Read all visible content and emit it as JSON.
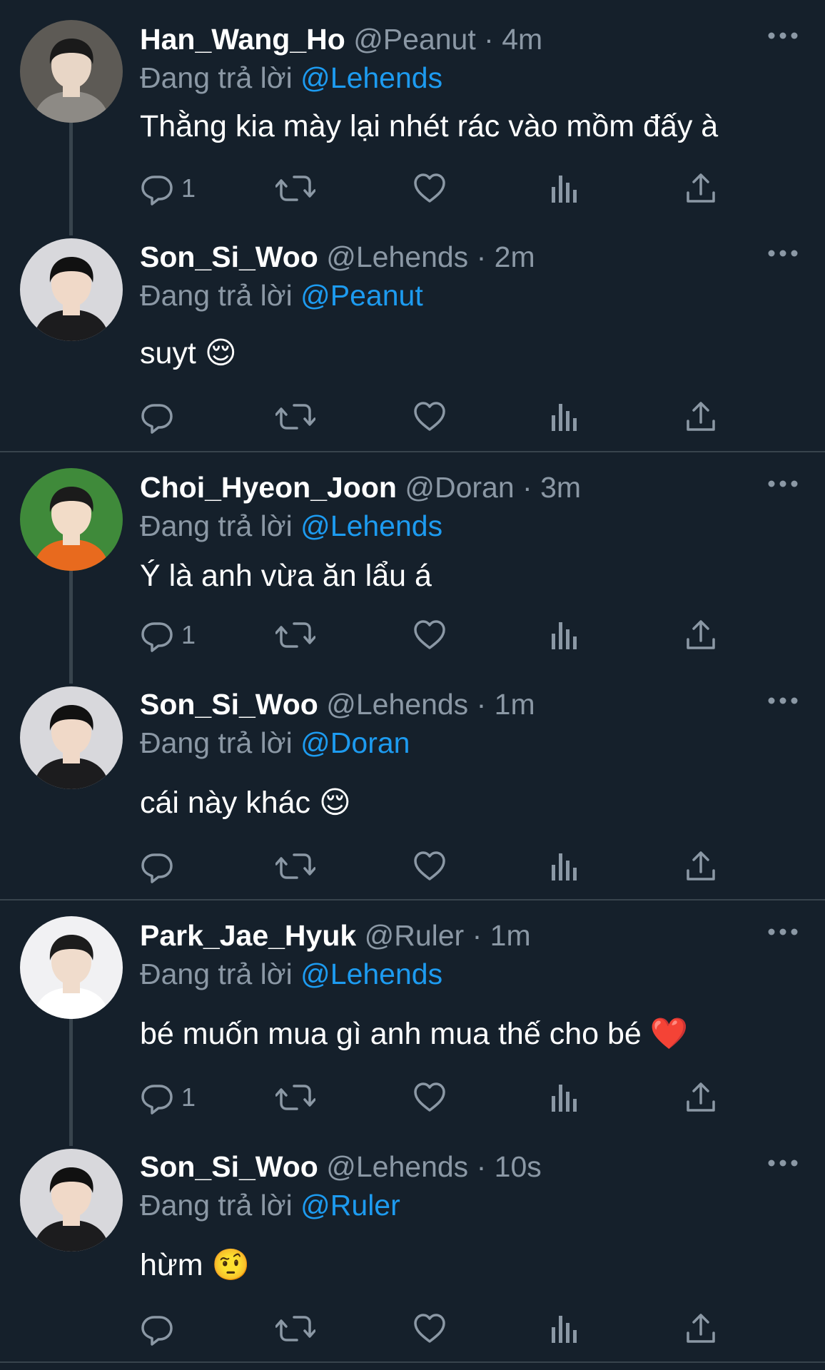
{
  "colors": {
    "background": "#15202b",
    "text": "#ffffff",
    "muted": "#8b98a5",
    "link": "#1d9bf0",
    "divider": "#38444d"
  },
  "labels": {
    "replying_to": "Đang trả lời",
    "dot": "·"
  },
  "tweets": [
    {
      "name": "Han_Wang_Ho",
      "handle": "@Peanut",
      "time": "4m",
      "reply_to": "@Lehends",
      "text": "Thằng kia mày lại nhét rác vào mồm đấy à",
      "emoji": "",
      "reply_count": "1",
      "avatar_icon": "avatar-photo"
    },
    {
      "name": "Son_Si_Woo",
      "handle": "@Lehends",
      "time": "2m",
      "reply_to": "@Peanut",
      "text": "suyt",
      "emoji": "😌",
      "reply_count": "",
      "avatar_icon": "avatar-photo"
    },
    {
      "name": "Choi_Hyeon_Joon",
      "handle": "@Doran",
      "time": "3m",
      "reply_to": "@Lehends",
      "text": "Ý là anh vừa ăn lẩu á",
      "emoji": "",
      "reply_count": "1",
      "avatar_icon": "avatar-photo"
    },
    {
      "name": "Son_Si_Woo",
      "handle": "@Lehends",
      "time": "1m",
      "reply_to": "@Doran",
      "text": "cái này khác",
      "emoji": "😌",
      "reply_count": "",
      "avatar_icon": "avatar-photo"
    },
    {
      "name": "Park_Jae_Hyuk",
      "handle": "@Ruler",
      "time": "1m",
      "reply_to": "@Lehends",
      "text": "bé muốn mua gì anh mua thế cho bé",
      "emoji": "❤️",
      "reply_count": "1",
      "avatar_icon": "avatar-photo"
    },
    {
      "name": "Son_Si_Woo",
      "handle": "@Lehends",
      "time": "10s",
      "reply_to": "@Ruler",
      "text": "hừm",
      "emoji": "🤨",
      "reply_count": "",
      "avatar_icon": "avatar-photo"
    }
  ],
  "action_icons": [
    "reply-icon",
    "retweet-icon",
    "like-icon",
    "views-icon",
    "share-icon"
  ]
}
